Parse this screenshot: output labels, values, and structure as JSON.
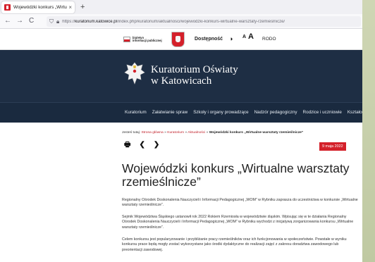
{
  "browser": {
    "tab_title": "Wojewódzki konkurs „Wirtualne w",
    "tab_close": "×",
    "new_tab": "+",
    "back": "←",
    "forward": "→",
    "reload": "C",
    "url_prefix": "https://",
    "url_host": "kuratorium.katowice.pl",
    "url_path": "/index.php/kuratorium/aktualnosci/wojewodzki-konkurs-wirtualne-warsztaty-rzemieslnicze/"
  },
  "site_top": {
    "bip_text_line1": "biuletyn",
    "bip_text_line2": "informacji publicznej",
    "accessibility": "Dostępność",
    "contrast_glyph": "◑",
    "font_small": "A",
    "font_large": "A",
    "rodo": "RODO"
  },
  "header": {
    "line1": "Kuratorium Oświaty",
    "line2": "w Katowicach"
  },
  "menu": [
    "Kuratorium",
    "Załatwianie spraw",
    "Szkoły i organy prowadzące",
    "Nadzór pedagogiczny",
    "Rodzice i uczniowie",
    "Kształcenie"
  ],
  "breadcrumb": {
    "prefix": "Jesteś tutaj: ",
    "home": "Strona główna",
    "sep": " » ",
    "section1": "Kuratorium",
    "section2": "Aktualności",
    "current": "Wojewódzki konkurs „Wirtualne warsztaty rzemieślnicze”"
  },
  "tools": {
    "print": "🖶",
    "prev": "❮",
    "next": "❯"
  },
  "article": {
    "date": "9 maja 2022",
    "title": "Wojewódzki konkurs „Wirtualne warsztaty rzemieślnicze”",
    "p1": "Regionalny Ośrodek Doskonalenia Nauczycieli i Informacji Pedagogicznej „WOM” w Rybniku zaprasza do uczestnictwa w konkursie „Wirtualne warsztaty rzemieślnicze”.",
    "p2": "Sejmik Województwa Śląskiego ustanowił rok 2022 Rokiem Rzemiosła w województwie śląskim. Wpisując się w te działania Regionalny Ośrodek Doskonalenia Nauczycieli i Informacji Pedagogicznej „WOM” w Rybniku wychodzi z inicjatywą zorganizowania konkursu „Wirtualne warsztaty rzemieślnicze”.",
    "p3": "Celem konkursu jest popularyzowanie i przybliżanie pracy rzemieślników oraz ich funkcjonowania w społeczeństwie. Powstałe w wyniku konkursu prace będą mogły zostać wykorzystane jako środki dydaktyczne do realizacji zajęć z zakresu doradztwa zawodowego lub preorientacji zawodowej."
  },
  "colors": {
    "accent_red": "#d4202a",
    "header_navy": "#1e2e44",
    "menu_navy": "#1a2a3f"
  }
}
